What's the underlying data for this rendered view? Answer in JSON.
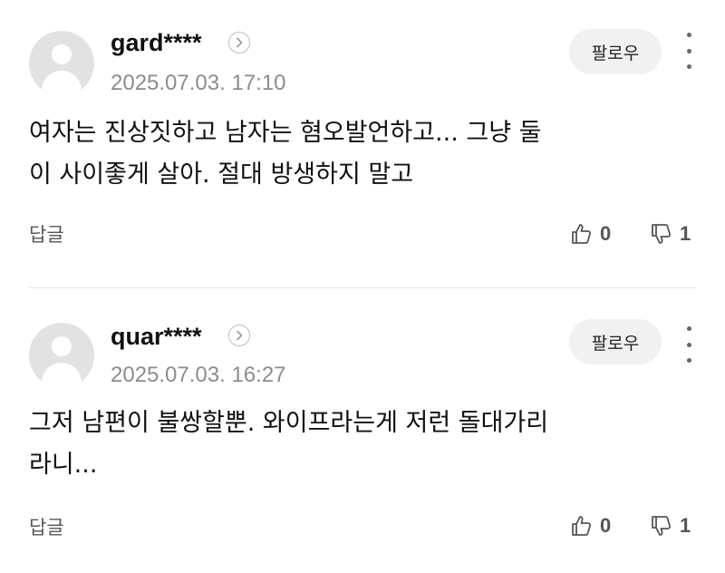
{
  "comments": [
    {
      "username": "gard****",
      "timestamp": "2025.07.03. 17:10",
      "follow_label": "팔로우",
      "text_line1": "여자는 진상짓하고 남자는 혐오발언하고... 그냥 둘",
      "text_line2": "이 사이좋게 살아. 절대 방생하지 말고",
      "reply_label": "답글",
      "likes": "0",
      "dislikes": "1"
    },
    {
      "username": "quar****",
      "timestamp": "2025.07.03. 16:27",
      "follow_label": "팔로우",
      "text_line1": "그저 남편이 불쌍할뿐. 와이프라는게 저런 돌대가리",
      "text_line2": "라니...",
      "reply_label": "답글",
      "likes": "0",
      "dislikes": "1"
    }
  ],
  "icons": {
    "avatar": "default-avatar-icon",
    "profile": "chevron-right-icon",
    "more": "more-vertical-icon",
    "like": "thumbs-up-icon",
    "dislike": "thumbs-down-icon"
  },
  "colors": {
    "avatar_bg": "#e2e2e2",
    "follow_bg": "#f1f1f1",
    "muted_text": "#8c8c8c",
    "divider": "#e6e6e6"
  }
}
